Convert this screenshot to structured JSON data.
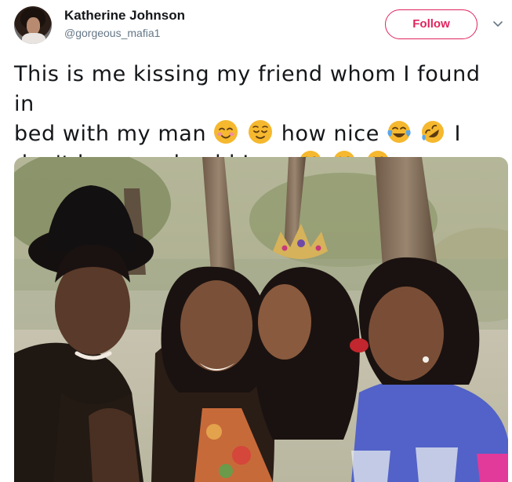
{
  "tweet": {
    "author": {
      "display_name": "Katherine Johnson",
      "handle": "@gorgeous_mafia1"
    },
    "follow_label": "Follow",
    "text": {
      "line1": "This is me kissing my friend whom I found in",
      "line2_start": "bed with my man",
      "line2_mid": "how nice",
      "line2_end": "I",
      "line3": "don't know... should I cry"
    },
    "emojis": [
      "smiling-blushing-face",
      "relieved-face",
      "face-with-tears-of-joy",
      "rolling-on-floor-laughing",
      "face-with-tears-of-joy",
      "face-with-tears-of-joy",
      "face-with-tears-of-joy"
    ],
    "media": {
      "subject": "four-women-photo"
    }
  },
  "colors": {
    "accent": "#e0245e",
    "text": "#14171a",
    "secondary_text": "#657786",
    "emoji_yellow": "#f5b82e"
  }
}
